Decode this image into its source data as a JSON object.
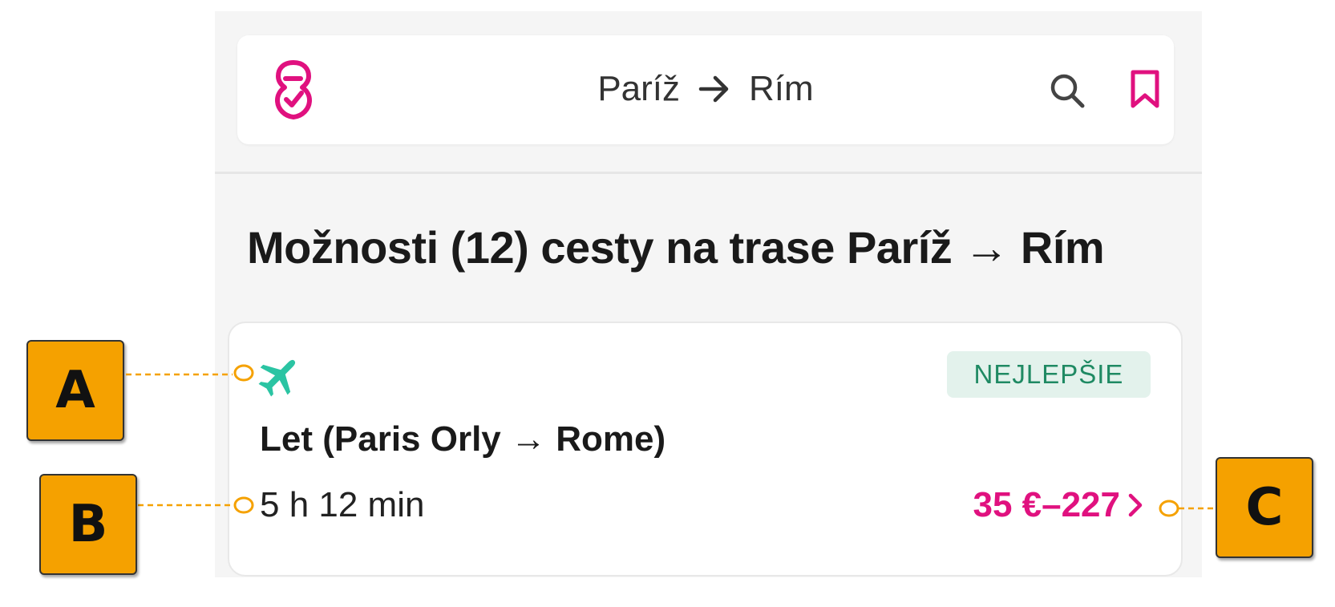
{
  "header": {
    "from": "Paríž",
    "to": "Rím",
    "logo_icon": "pin-check-logo",
    "search_icon": "search-icon",
    "bookmark_icon": "bookmark-icon"
  },
  "heading": "Možnosti (12) cesty na trase Paríž → Rím",
  "result": {
    "mode_icon": "airplane-icon",
    "badge": "NEJLEPŠIE",
    "title": "Let (Paris Orly → Rome)",
    "duration": "5 h 12 min",
    "price": "35 €–227"
  },
  "annotations": {
    "a": "A",
    "b": "B",
    "c": "C"
  },
  "colors": {
    "brand": "#e0117f",
    "plane": "#2bc4a3",
    "badge_bg": "#e3f2ec",
    "badge_text": "#1f8a63",
    "callout": "#f5a100"
  }
}
